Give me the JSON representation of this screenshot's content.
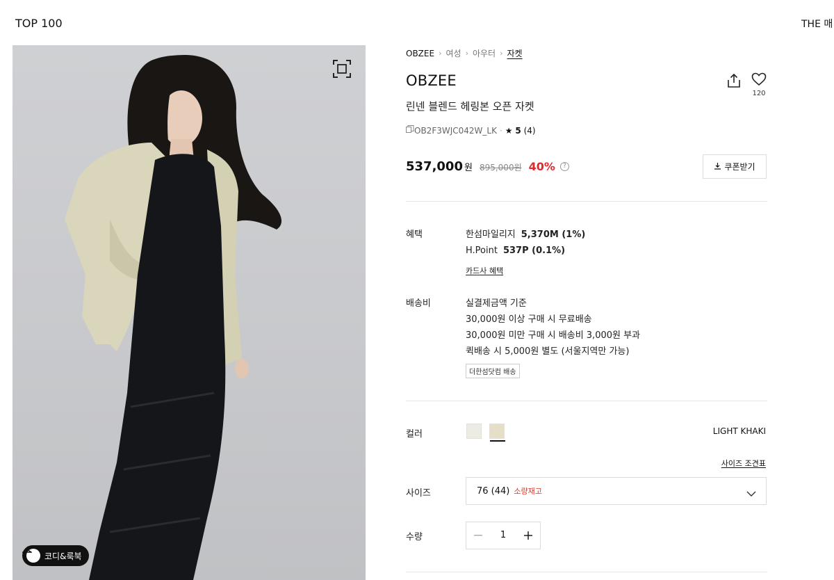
{
  "topnav": {
    "left_label": "TOP 100",
    "right_label": "THE 매"
  },
  "gallery": {
    "coordi_label": "코디&룩북"
  },
  "breadcrumb": [
    "OBZEE",
    "여성",
    "아우터",
    "자켓"
  ],
  "product": {
    "brand": "OBZEE",
    "name": "린넨 블렌드 헤링본 오픈 자켓",
    "code": "OB2F3WJC042W_LK",
    "code_sep": "·",
    "rating": "5",
    "review_count": "(4)",
    "like_count": "120"
  },
  "price": {
    "sale": "537,000",
    "won": "원",
    "original": "895,000원",
    "discount": "40%",
    "help": "?",
    "coupon_label": "쿠폰받기"
  },
  "benefits": {
    "label": "혜택",
    "mileage_name": "한섬마일리지",
    "mileage_value": "5,370M (1%)",
    "hpoint_name": "H.Point",
    "hpoint_value": "537P (0.1%)",
    "card_link": "카드사 혜택"
  },
  "shipping": {
    "label": "배송비",
    "lines": [
      "실결제금액 기준",
      "30,000원 이상 구매 시 무료배송",
      "30,000원 미만 구매 시 배송비 3,000원 부과",
      "퀵배송 시 5,000원 별도 (서울지역만 가능)"
    ],
    "tag": "더한섬닷컴 배송"
  },
  "color": {
    "label": "컬러",
    "selected_name": "LIGHT KHAKI",
    "swatches": [
      "#ecebe4",
      "#e6dfc8"
    ]
  },
  "size": {
    "chart_link": "사이즈 조견표",
    "label": "사이즈",
    "selected": "76 (44)",
    "stock_note": "소량재고"
  },
  "quantity": {
    "label": "수량",
    "value": "1"
  },
  "colors": {
    "discount_red": "#e0292b",
    "stock_red": "#d43a2a"
  }
}
